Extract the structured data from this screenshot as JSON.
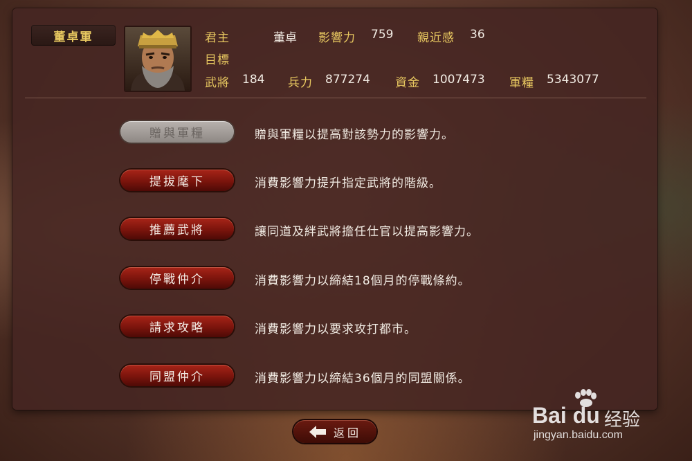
{
  "faction": {
    "name": "董卓軍"
  },
  "ruler": {
    "label": "君主",
    "name": "董卓"
  },
  "influence": {
    "label": "影響力",
    "value": "759"
  },
  "affinity": {
    "label": "親近感",
    "value": "36"
  },
  "target": {
    "label": "目標"
  },
  "stats": {
    "generals": {
      "label": "武將",
      "value": "184"
    },
    "troops": {
      "label": "兵力",
      "value": "877274"
    },
    "funds": {
      "label": "資金",
      "value": "1007473"
    },
    "provisions": {
      "label": "軍糧",
      "value": "5343077"
    }
  },
  "commands": [
    {
      "label": "贈與軍糧",
      "description": "贈與軍糧以提高對該勢力的影響力。",
      "enabled": false
    },
    {
      "label": "提拔麾下",
      "description": "消費影響力提升指定武將的階級。",
      "enabled": true
    },
    {
      "label": "推薦武將",
      "description": "讓同道及絆武將擔任仕官以提高影響力。",
      "enabled": true
    },
    {
      "label": "停戰仲介",
      "description": "消費影響力以締結18個月的停戰條約。",
      "enabled": true
    },
    {
      "label": "請求攻略",
      "description": "消費影響力以要求攻打都市。",
      "enabled": true
    },
    {
      "label": "同盟仲介",
      "description": "消費影響力以締結36個月的同盟關係。",
      "enabled": true
    }
  ],
  "back_button": {
    "label": "返回",
    "icon": "left-arrow-icon"
  },
  "watermark": {
    "logo": "Bai du",
    "brand": "经验",
    "url": "jingyan.baidu.com"
  }
}
